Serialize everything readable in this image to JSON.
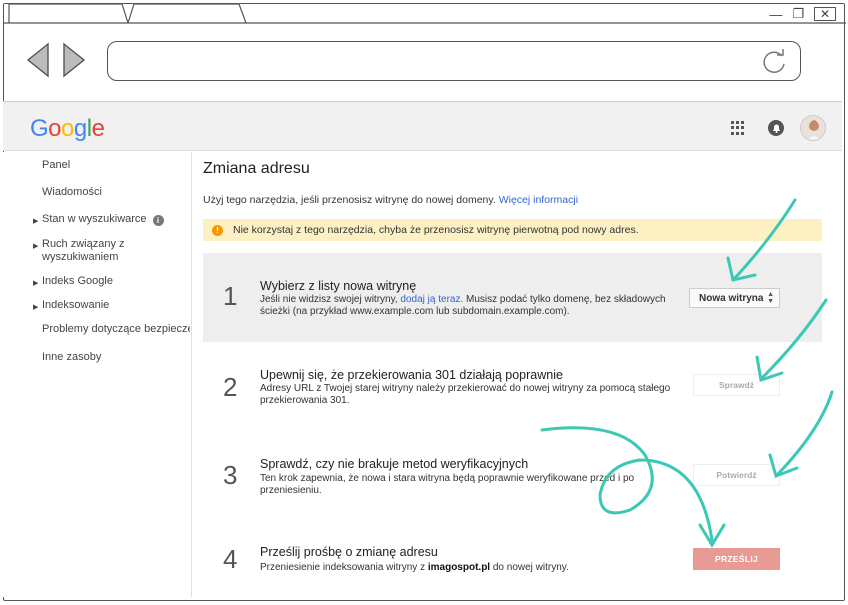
{
  "header": {
    "logo": [
      "G",
      "o",
      "o",
      "g",
      "l",
      "e"
    ],
    "logo_colors": [
      "#4285f4",
      "#ea4335",
      "#fbbc05",
      "#4285f4",
      "#34a853",
      "#ea4335"
    ]
  },
  "sidebar": {
    "items": [
      {
        "label": "Panel",
        "expandable": false
      },
      {
        "label": "Wiadomości",
        "expandable": false
      },
      {
        "label": "Stan w wyszukiwarce",
        "expandable": true,
        "info": "i"
      },
      {
        "label_line1": "Ruch związany z",
        "label_line2": "wyszukiwaniem",
        "expandable": true
      },
      {
        "label": "Indeks Google",
        "expandable": true
      },
      {
        "label": "Indeksowanie",
        "expandable": true
      },
      {
        "label": "Problemy dotyczące bezpieczeństwa",
        "expandable": false
      },
      {
        "label": "Inne zasoby",
        "expandable": false
      }
    ]
  },
  "main": {
    "title": "Zmiana adresu",
    "intro_text": "Użyj tego narzędzia, jeśli przenosisz witrynę do nowej domeny.",
    "intro_link": "Więcej informacji",
    "warning_icon": "!",
    "warning": "Nie korzystaj z tego narzędzia, chyba że przenosisz witrynę pierwotną pod nowy adres.",
    "steps": [
      {
        "number": "1",
        "title": "Wybierz z listy nowa witrynę",
        "desc_prefix": "Jeśli nie widzisz swojej witryny,",
        "desc_link": "dodaj ją teraz.",
        "desc_suffix": "Musisz podać tylko domenę, bez składowych ścieżki (na przykład www.example.com lub subdomain.example.com).",
        "action": "Nowa witryna"
      },
      {
        "number": "2",
        "title": "Upewnij się, że przekierowania 301 działają poprawnie",
        "desc": "Adresy URL z Twojej starej witryny należy przekierować do nowej witryny za pomocą stałego przekierowania 301.",
        "action": "Sprawdź"
      },
      {
        "number": "3",
        "title": "Sprawdź, czy nie brakuje metod weryfikacyjnych",
        "desc": "Ten krok zapewnia, że nowa i stara witryna będą poprawnie weryfikowane przed i po przeniesieniu.",
        "action": "Potwierdź"
      },
      {
        "number": "4",
        "title": "Prześlij prośbę o zmianę adresu",
        "desc_prefix": "Przeniesienie indeksowania witryny z",
        "desc_bold": "imagospot.pl",
        "desc_suffix": "do nowej witryny.",
        "action": "PRZEŚLIJ"
      }
    ]
  },
  "colors": {
    "accent_link": "#3366cc",
    "warning_bg": "#fdf1c4",
    "submit_button": "#e89a94",
    "arrow_teal": "#3cc8b4"
  }
}
